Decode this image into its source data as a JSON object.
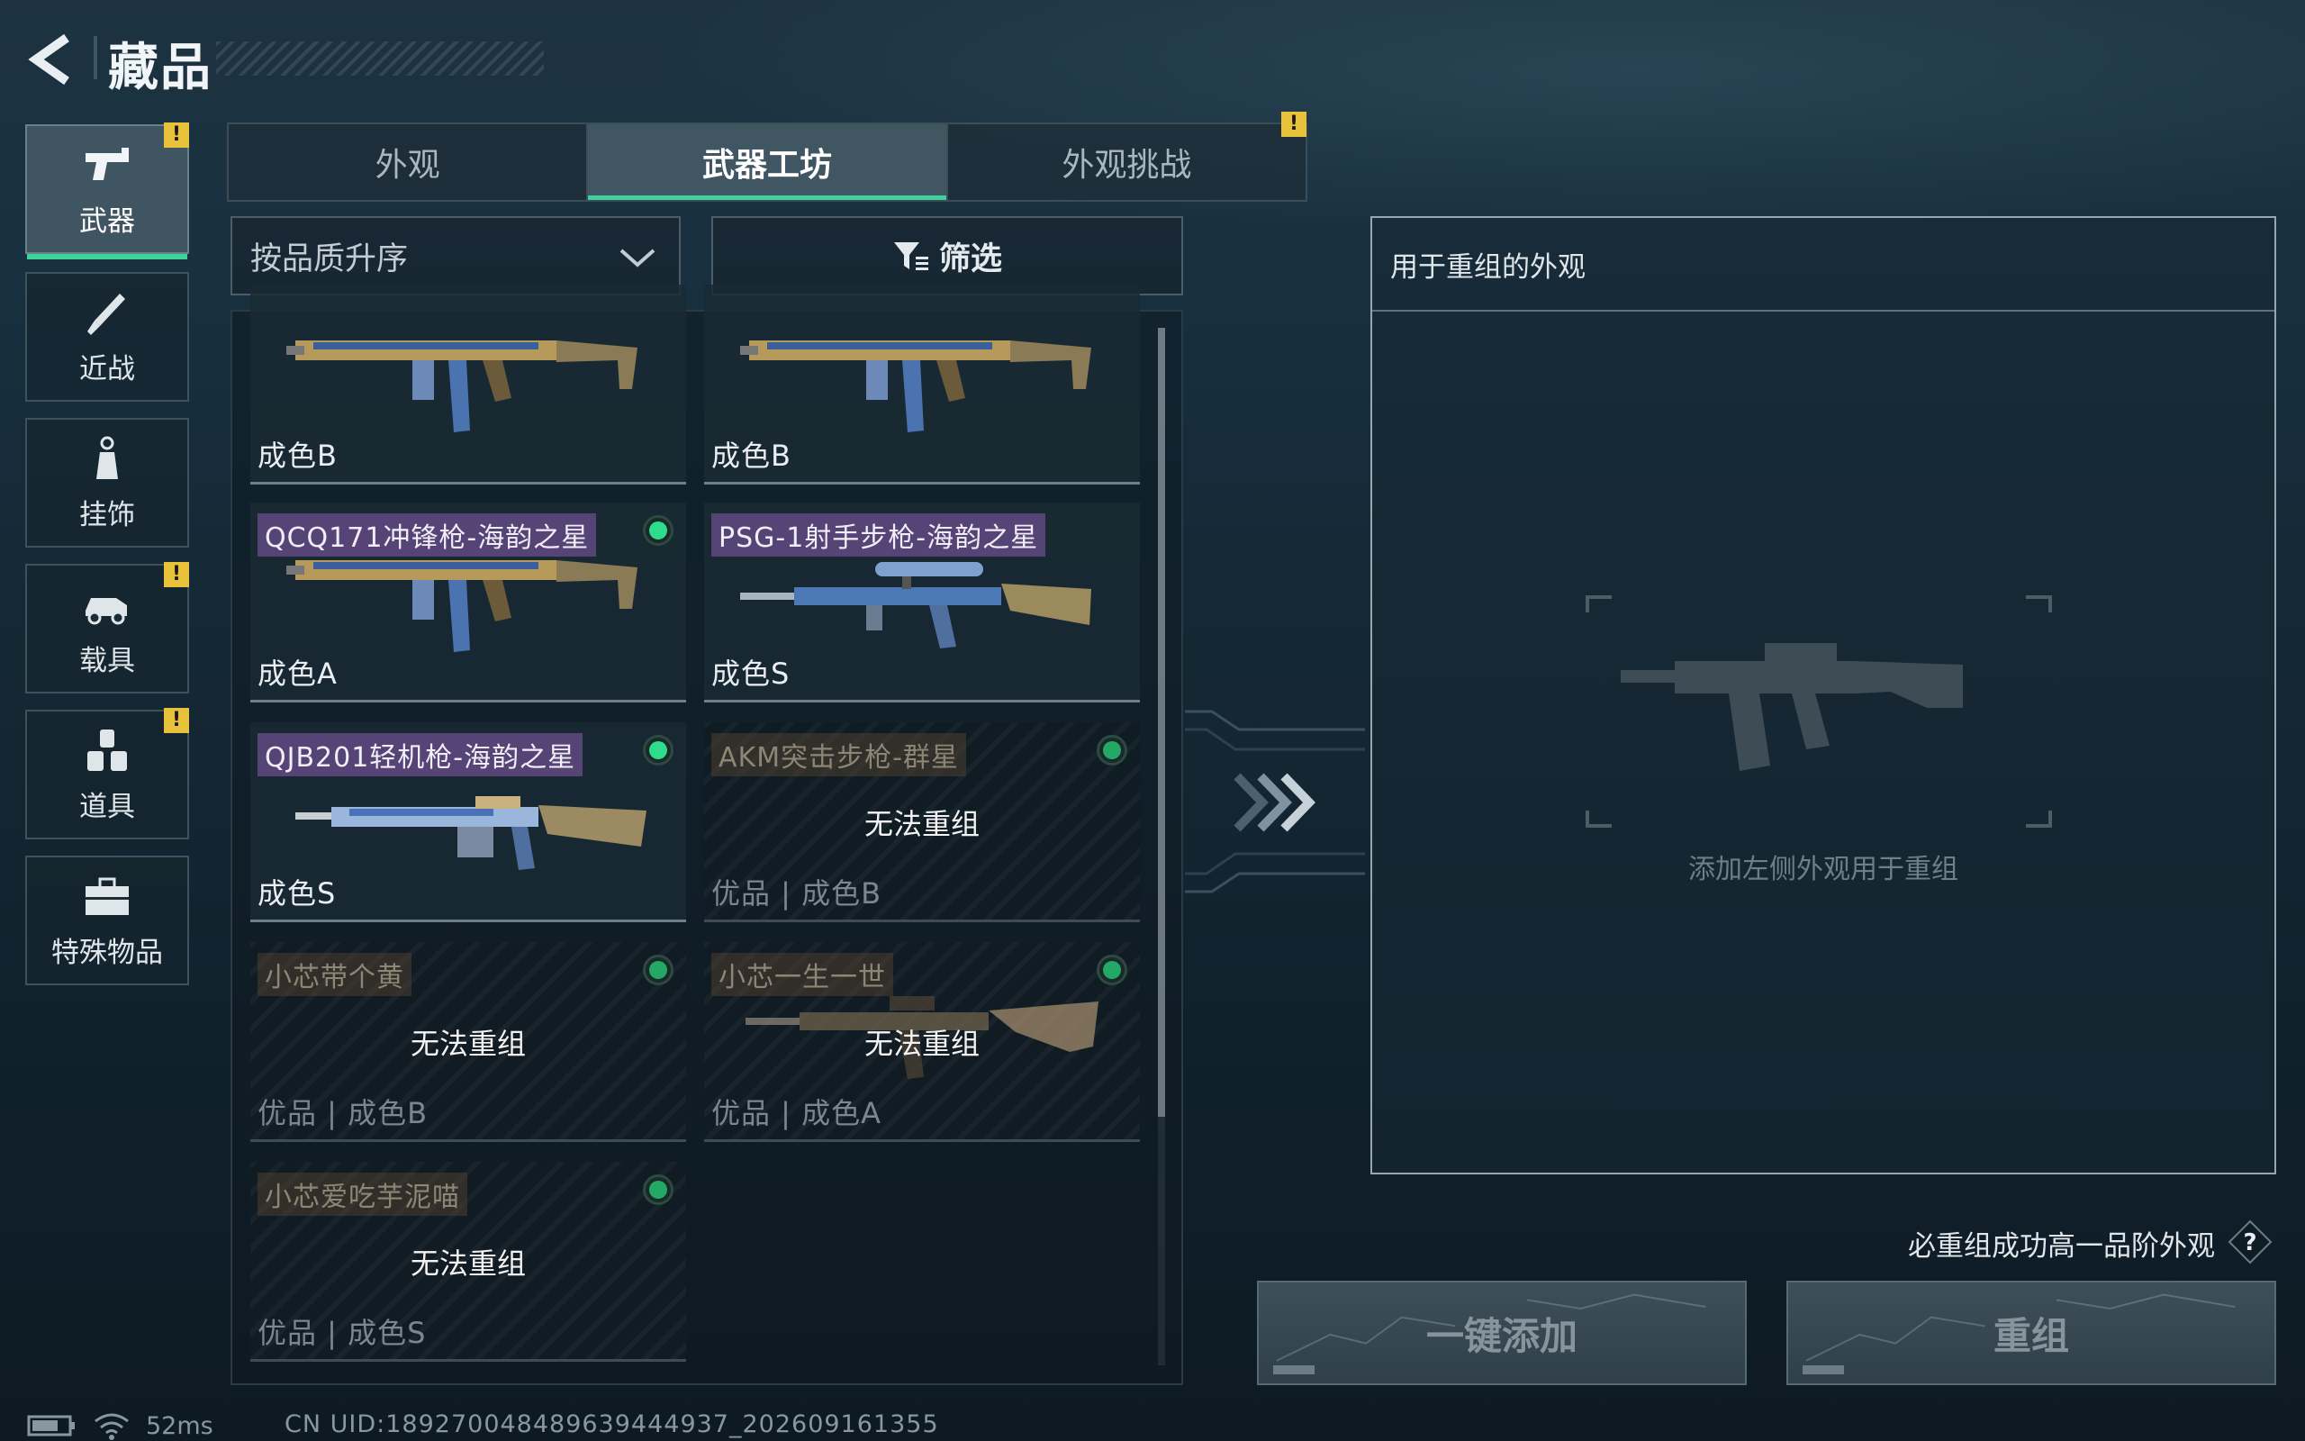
{
  "header": {
    "title": "藏品"
  },
  "categories": [
    {
      "label": "武器",
      "icon": "pistol-icon",
      "active": true,
      "warning": true
    },
    {
      "label": "近战",
      "icon": "knife-icon",
      "active": false,
      "warning": false
    },
    {
      "label": "挂饰",
      "icon": "charm-icon",
      "active": false,
      "warning": false
    },
    {
      "label": "载具",
      "icon": "car-icon",
      "active": false,
      "warning": true
    },
    {
      "label": "道具",
      "icon": "grenades-icon",
      "active": false,
      "warning": true
    },
    {
      "label": "特殊物品",
      "icon": "toolbox-icon",
      "active": false,
      "warning": false
    }
  ],
  "warning_mark": "!",
  "tabs": [
    {
      "label": "外观",
      "active": false
    },
    {
      "label": "武器工坊",
      "active": true
    },
    {
      "label": "外观挑战",
      "active": false,
      "warning": true
    }
  ],
  "sort": {
    "label": "按品质升序"
  },
  "filter": {
    "label": "筛选"
  },
  "cards": [
    {
      "name": "",
      "grade": "成色B",
      "selectable": true,
      "gun": "smg"
    },
    {
      "name": "",
      "grade": "成色B",
      "selectable": true,
      "gun": "smg"
    },
    {
      "name": "QCQ171冲锋枪-海韵之星",
      "grade": "成色A",
      "selectable": true,
      "gun": "smg"
    },
    {
      "name": "PSG-1射手步枪-海韵之星",
      "grade": "成色S",
      "selectable": true,
      "gun": "sniper"
    },
    {
      "name": "QJB201轻机枪-海韵之星",
      "grade": "成色S",
      "selectable": true,
      "gun": "lmg"
    },
    {
      "name": "AKM突击步枪-群星",
      "grade": "优品 | 成色B",
      "selectable": false,
      "locked_text": "无法重组"
    },
    {
      "name": "小芯带个黄",
      "grade": "优品 | 成色B",
      "selectable": false,
      "locked_text": "无法重组"
    },
    {
      "name": "小芯一生一世",
      "grade": "优品 | 成色A",
      "selectable": false,
      "locked_text": "无法重组",
      "gun": "rifle"
    },
    {
      "name": "小芯爱吃芋泥喵",
      "grade": "优品 | 成色S",
      "selectable": false,
      "locked_text": "无法重组"
    }
  ],
  "panel": {
    "title": "用于重组的外观",
    "placeholder": "添加左侧外观用于重组"
  },
  "notice": "必重组成功高一品阶外观",
  "buttons": {
    "add_all": "一键添加",
    "recombine": "重组"
  },
  "status": {
    "ping": "52ms",
    "uid": "CN UID:18927004848963944493​7_202609161355"
  },
  "colors": {
    "accent": "#3fd29a",
    "warning": "#e7c23a",
    "name_tag": "#6c4e8e"
  }
}
